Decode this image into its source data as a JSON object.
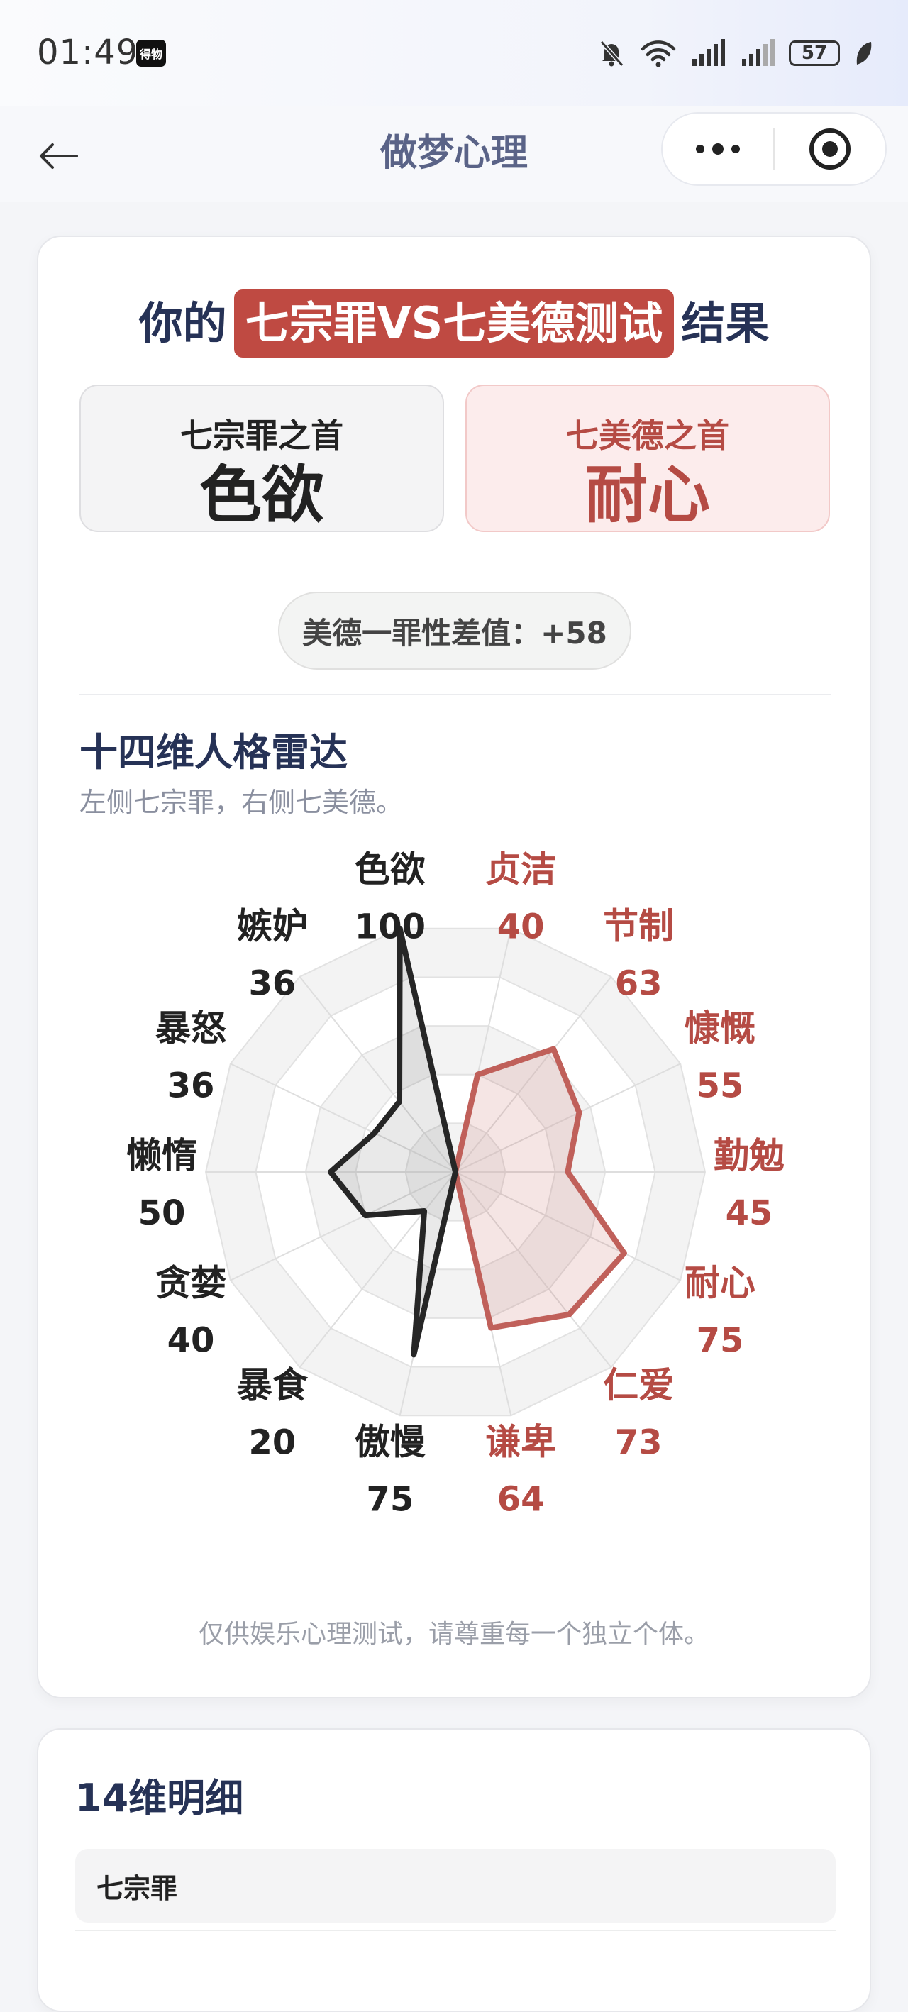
{
  "status_bar": {
    "time": "01:49",
    "app_badge": "得物",
    "battery": "57"
  },
  "nav": {
    "title": "做梦心理"
  },
  "result": {
    "title_prefix": "你的",
    "title_highlight": "七宗罪VS七美德测试",
    "title_suffix": "结果",
    "top_sin_label": "七宗罪之首",
    "top_sin_value": "色欲",
    "top_virtue_label": "七美德之首",
    "top_virtue_value": "耐心",
    "diff_text": "美德一罪性差值：+58"
  },
  "radar_section": {
    "title": "十四维人格雷达",
    "subtitle": "左侧七宗罪，右侧七美德。",
    "disclaimer": "仅供娱乐心理测试，请尊重每一个独立个体。"
  },
  "chart_data": {
    "type": "radar",
    "axes": [
      {
        "name": "贞洁",
        "value": 40,
        "group": "virtue"
      },
      {
        "name": "节制",
        "value": 63,
        "group": "virtue"
      },
      {
        "name": "慷慨",
        "value": 55,
        "group": "virtue"
      },
      {
        "name": "勤勉",
        "value": 45,
        "group": "virtue"
      },
      {
        "name": "耐心",
        "value": 75,
        "group": "virtue"
      },
      {
        "name": "仁爱",
        "value": 73,
        "group": "virtue"
      },
      {
        "name": "谦卑",
        "value": 64,
        "group": "virtue"
      },
      {
        "name": "傲慢",
        "value": 75,
        "group": "sin"
      },
      {
        "name": "暴食",
        "value": 20,
        "group": "sin"
      },
      {
        "name": "贪婪",
        "value": 40,
        "group": "sin"
      },
      {
        "name": "懒惰",
        "value": 50,
        "group": "sin"
      },
      {
        "name": "暴怒",
        "value": 36,
        "group": "sin"
      },
      {
        "name": "嫉妒",
        "value": 36,
        "group": "sin"
      },
      {
        "name": "色欲",
        "value": 100,
        "group": "sin"
      }
    ],
    "range": [
      0,
      100
    ],
    "rings": 5,
    "colors": {
      "sin": "#262626",
      "virtue": "#c0605a"
    }
  },
  "details": {
    "title": "14维明细",
    "sin_header": "七宗罪"
  }
}
